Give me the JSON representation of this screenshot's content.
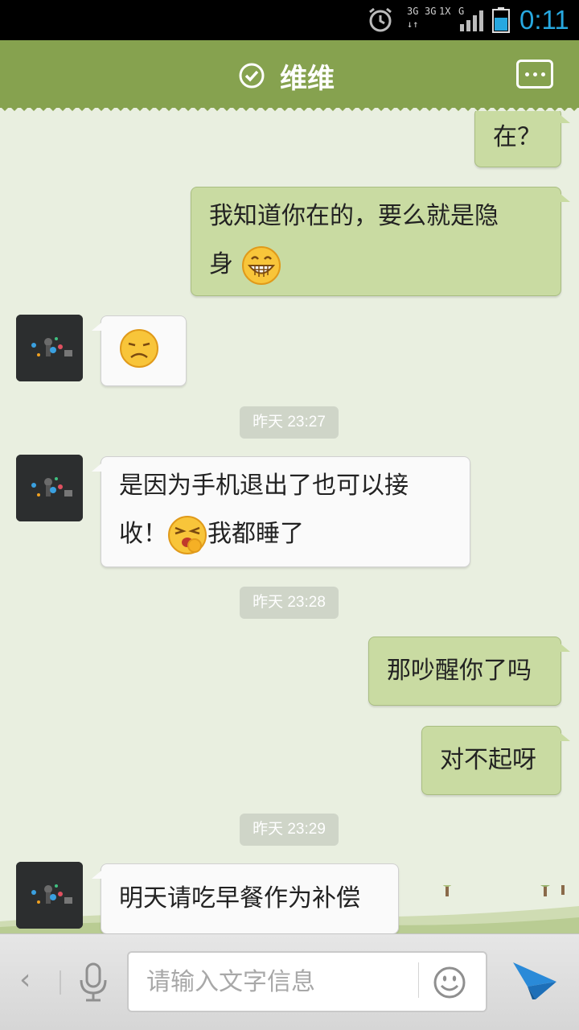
{
  "status_bar": {
    "time": "0:11",
    "network_1": "3G",
    "network_2": "3G",
    "network_3": "1X",
    "network_4": "G",
    "icons": [
      "alarm-icon",
      "signal-icon",
      "battery-icon"
    ]
  },
  "header": {
    "title": "维维",
    "status_icon": "online-check-icon",
    "menu_icon": "more-options-icon"
  },
  "messages": [
    {
      "side": "out",
      "text": "在？"
    },
    {
      "side": "out",
      "text_1": "我知道你在的，要么就是隐",
      "text_2": "身",
      "emoji": "grin-emoji"
    },
    {
      "side": "in",
      "emoji": "sad-emoji"
    },
    {
      "side": "time",
      "text": "昨天 23:27"
    },
    {
      "side": "in",
      "text_1": "是因为手机退出了也可以接",
      "text_2": "收！",
      "emoji": "yawn-emoji",
      "text_3": "我都睡了"
    },
    {
      "side": "time",
      "text": "昨天 23:28"
    },
    {
      "side": "out",
      "text": "那吵醒你了吗"
    },
    {
      "side": "out",
      "text": "对不起呀"
    },
    {
      "side": "time",
      "text": "昨天 23:29"
    },
    {
      "side": "in",
      "text": "明天请吃早餐作为补偿"
    }
  ],
  "input": {
    "placeholder": "请输入文字信息",
    "value": ""
  },
  "colors": {
    "header": "#86a24f",
    "outgoing_bubble": "#c9dba2",
    "incoming_bubble": "#fafafa",
    "background": "#e9efe0",
    "time_accent": "#27a8e0",
    "send_icon": "#2a8ad8"
  }
}
